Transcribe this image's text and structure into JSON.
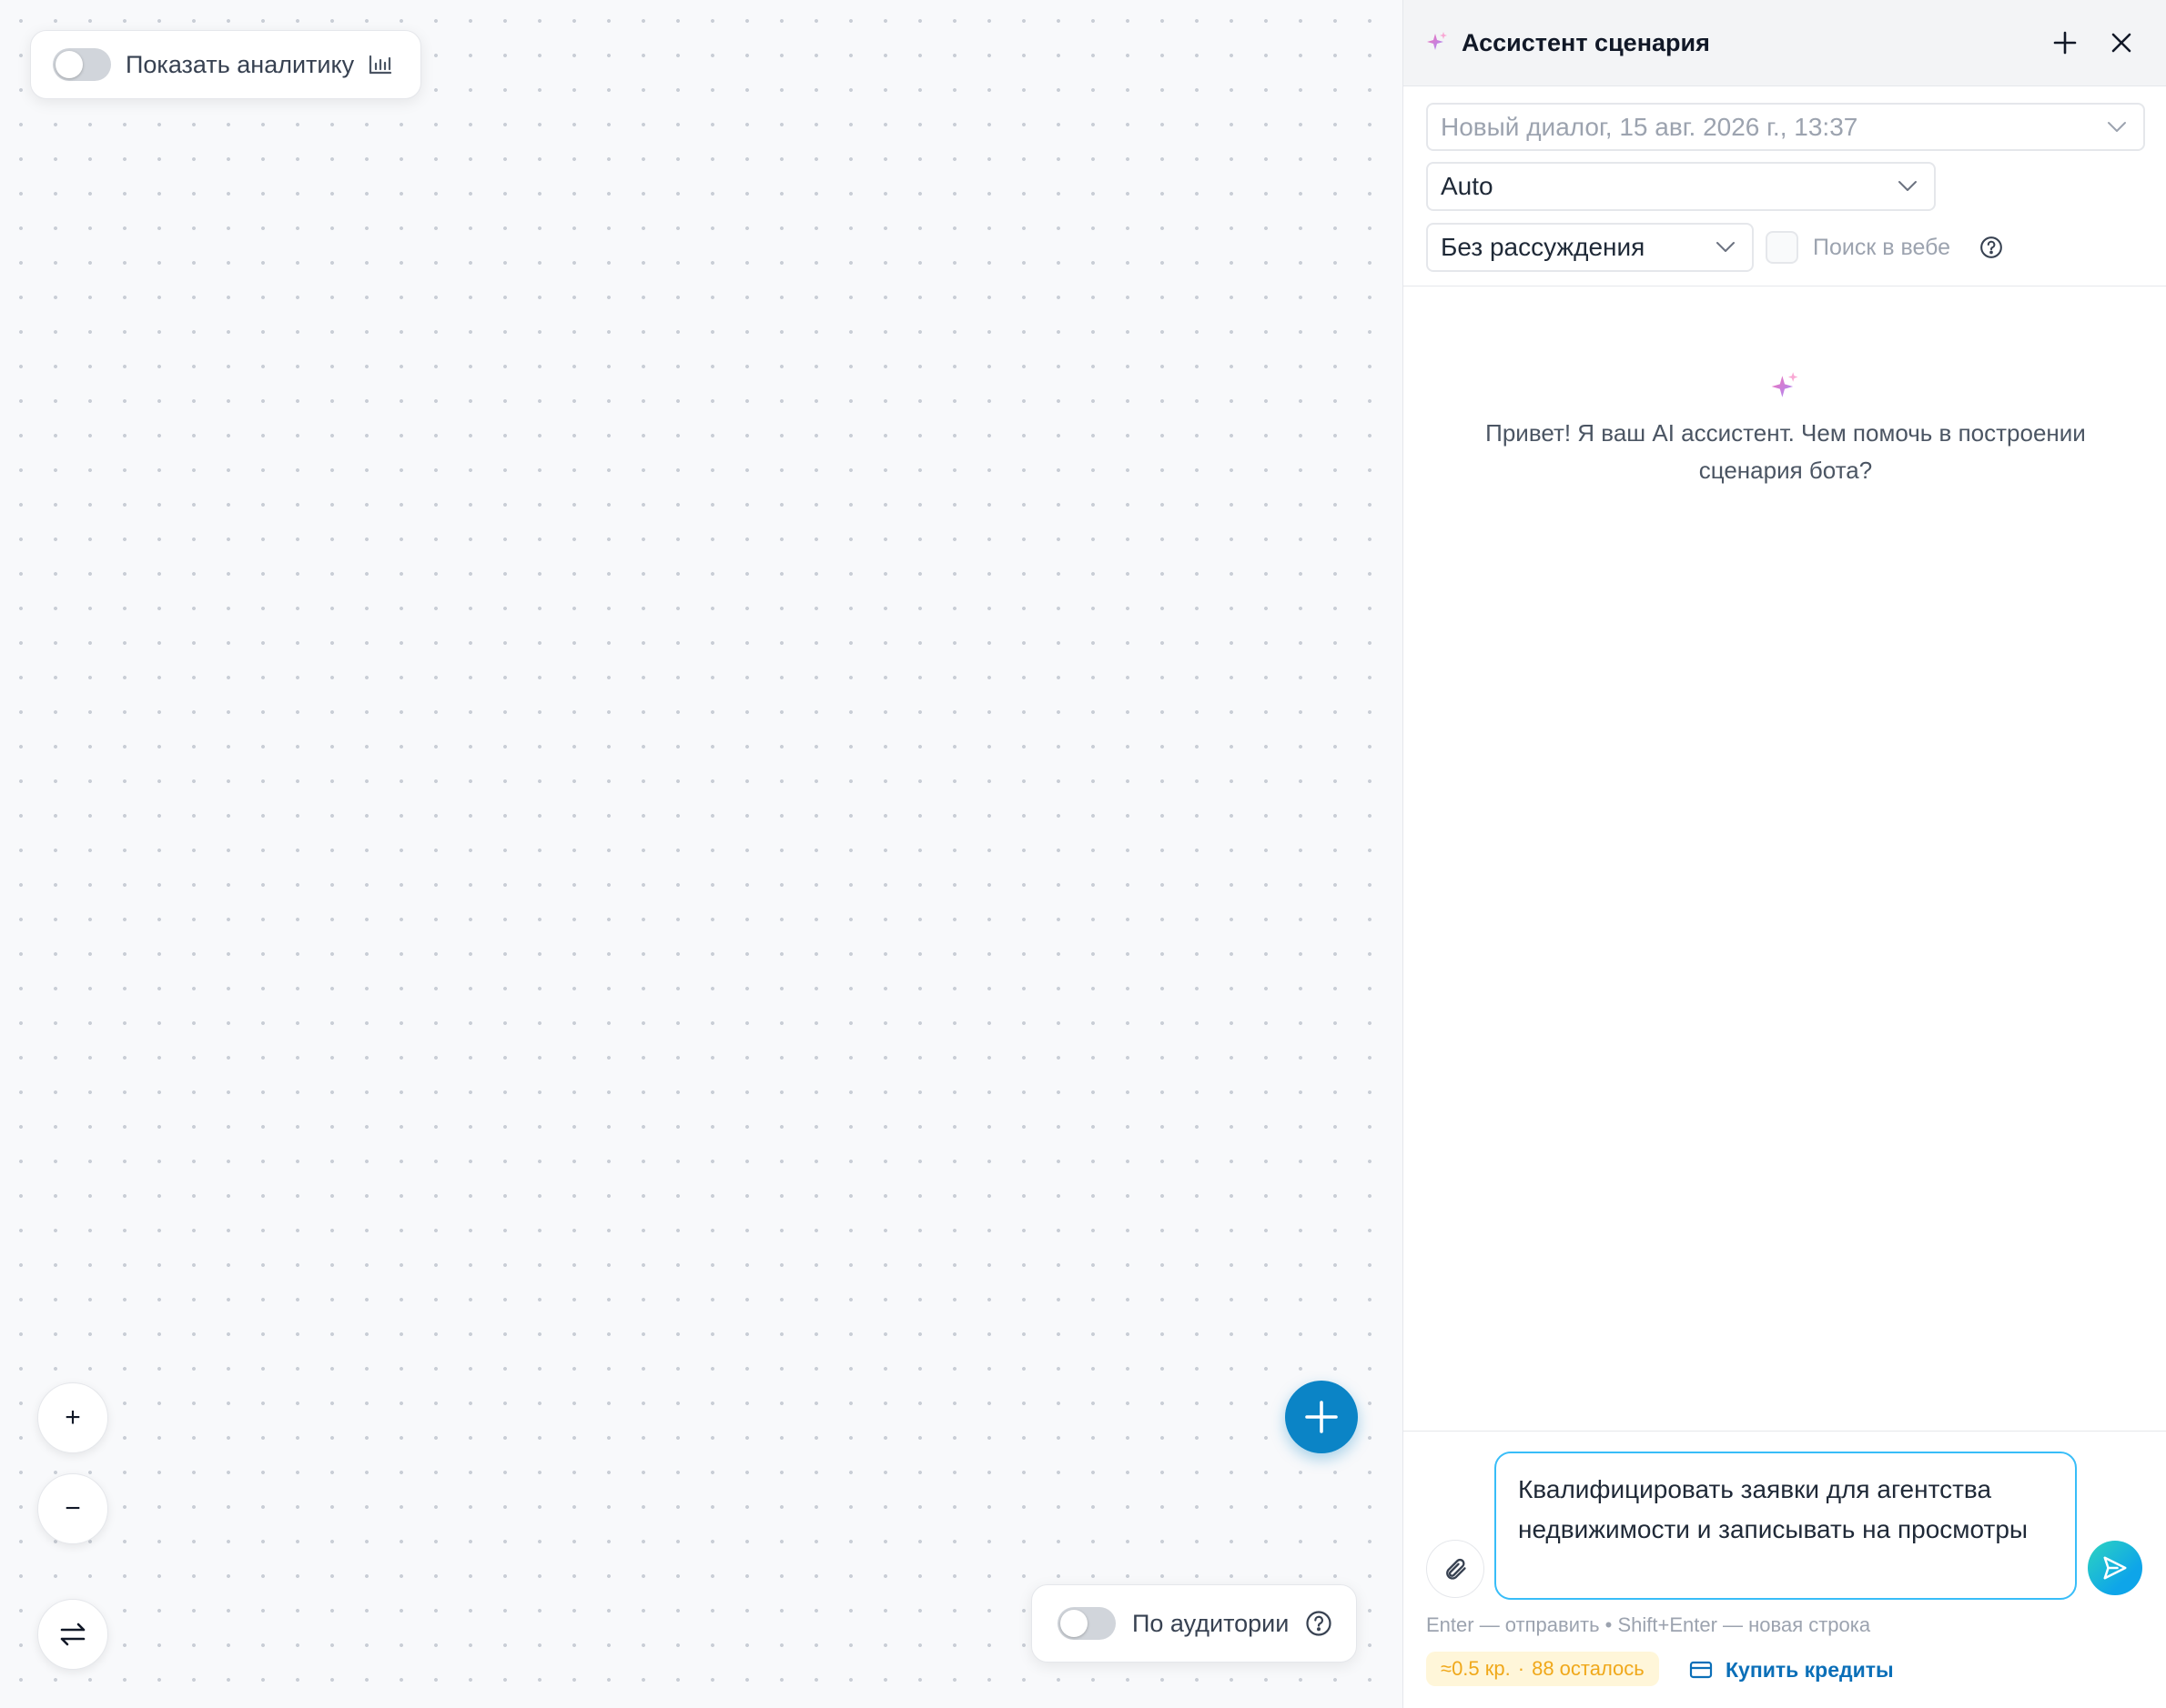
{
  "canvas": {
    "analytics_toggle": {
      "label": "Показать аналитику",
      "checked": false,
      "icon": "bar-chart-icon"
    },
    "audience_toggle": {
      "label": "По аудитории",
      "checked": false,
      "icon": "help-circle-icon"
    },
    "zoom_in_label": "+",
    "zoom_out_label": "−",
    "swap_icon": "swap-arrows-icon",
    "add_icon": "plus-icon",
    "add_button_color": "#0b84c6"
  },
  "panel": {
    "title": "Ассистент сценария",
    "title_icon": "sparkle-icon",
    "dialog_select": {
      "value": "Новый диалог, 15 авг. 2026 г., 13:37"
    },
    "model_select": {
      "value": "Auto"
    },
    "reasoning_select": {
      "value": "Без рассуждения"
    },
    "web_search": {
      "label": "Поиск в вебе",
      "checked": false
    },
    "welcome": "Привет! Я ваш AI ассистент. Чем помочь в построении сценария бота?",
    "composer": {
      "value": "Квалифицировать заявки для агентства недвижимости и записывать на просмотры",
      "hint": "Enter — отправить • Shift+Enter — новая строка"
    },
    "credits": {
      "cost": "≈0.5 кр.",
      "separator": "·",
      "remaining": "88 осталось"
    },
    "buy_credits": "Купить кредиты"
  }
}
